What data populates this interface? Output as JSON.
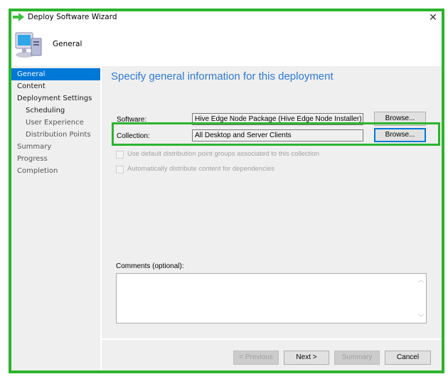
{
  "window": {
    "title": "Deploy Software Wizard",
    "close_glyph": "✕"
  },
  "header": {
    "title": "General"
  },
  "sidebar": {
    "items": [
      {
        "label": "General",
        "state": "active"
      },
      {
        "label": "Content",
        "state": "normal"
      },
      {
        "label": "Deployment Settings",
        "state": "normal"
      },
      {
        "label": "Scheduling",
        "state": "normal"
      },
      {
        "label": "User Experience",
        "state": "dim"
      },
      {
        "label": "Distribution Points",
        "state": "dim"
      },
      {
        "label": "Summary",
        "state": "dim"
      },
      {
        "label": "Progress",
        "state": "dim"
      },
      {
        "label": "Completion",
        "state": "dim"
      }
    ]
  },
  "main": {
    "heading": "Specify general information for this deployment",
    "software": {
      "label": "Software:",
      "value": "Hive Edge Node Package (Hive Edge Node Installer)",
      "browse_label": "Browse..."
    },
    "collection": {
      "label": "Collection:",
      "value": "All Desktop and Server Clients",
      "browse_label": "Browse..."
    },
    "checkboxes": [
      {
        "label": "Use default distribution point groups associated to this collection",
        "checked": false,
        "enabled": false
      },
      {
        "label": "Automatically distribute content for dependencies",
        "checked": false,
        "enabled": false
      }
    ],
    "comments": {
      "label": "Comments (optional):",
      "value": ""
    }
  },
  "footer": {
    "previous_label": "< Previous",
    "next_label": "Next >",
    "summary_label": "Summary",
    "cancel_label": "Cancel"
  },
  "colors": {
    "accent": "#0078d7",
    "heading": "#2e7ad6",
    "highlight": "#2db42d"
  }
}
